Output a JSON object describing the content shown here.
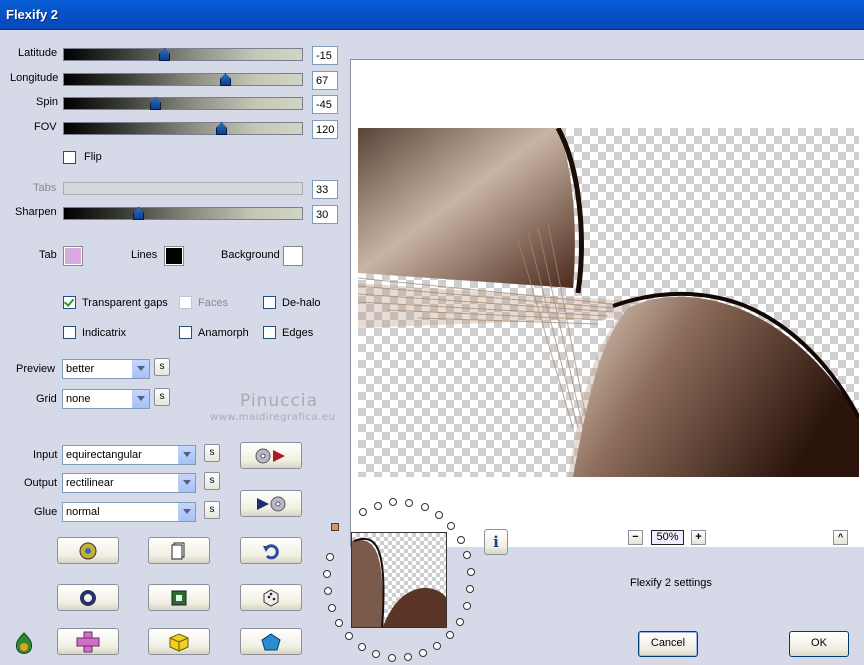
{
  "window": {
    "title": "Flexify 2"
  },
  "sliders": {
    "latitude": {
      "label": "Latitude",
      "value": "-15",
      "position": 0.42
    },
    "longitude": {
      "label": "Longitude",
      "value": "67",
      "position": 0.68
    },
    "spin": {
      "label": "Spin",
      "value": "-45",
      "position": 0.38
    },
    "fov": {
      "label": "FOV",
      "value": "120",
      "position": 0.66
    },
    "tabs": {
      "label": "Tabs",
      "value": "33",
      "disabled": true
    },
    "sharpen": {
      "label": "Sharpen",
      "value": "30",
      "position": 0.31
    }
  },
  "flip": {
    "label": "Flip",
    "checked": false
  },
  "colors": {
    "tab": {
      "label": "Tab",
      "color": "#d8a8e0"
    },
    "lines": {
      "label": "Lines",
      "color": "#000000"
    },
    "background": {
      "label": "Background",
      "color": "#ffffff"
    }
  },
  "options": {
    "transparent_gaps": {
      "label": "Transparent gaps",
      "checked": true
    },
    "faces": {
      "label": "Faces",
      "checked": false,
      "disabled": true
    },
    "de_halo": {
      "label": "De-halo",
      "checked": false
    },
    "indicatrix": {
      "label": "Indicatrix",
      "checked": false
    },
    "anamorph": {
      "label": "Anamorph",
      "checked": false
    },
    "edges": {
      "label": "Edges",
      "checked": false
    }
  },
  "dropdowns": {
    "preview": {
      "label": "Preview",
      "value": "better"
    },
    "grid": {
      "label": "Grid",
      "value": "none"
    },
    "input": {
      "label": "Input",
      "value": "equirectangular"
    },
    "output": {
      "label": "Output",
      "value": "rectilinear"
    },
    "glue": {
      "label": "Glue",
      "value": "normal"
    }
  },
  "s_button_label": "s",
  "watermark": {
    "name": "Pinuccia",
    "url": "www.maidiregrafica.eu"
  },
  "zoom": {
    "level": "50%",
    "minus": "−",
    "plus": "+"
  },
  "caret_label": "^",
  "info_label": "i",
  "settings_label": "Flexify 2 settings",
  "buttons": {
    "cancel": "Cancel",
    "ok": "OK"
  },
  "accent_colors": {
    "titlebar": "#0553c9",
    "panel": "#d6d9e8",
    "image_brown": "#7a5a4a"
  }
}
